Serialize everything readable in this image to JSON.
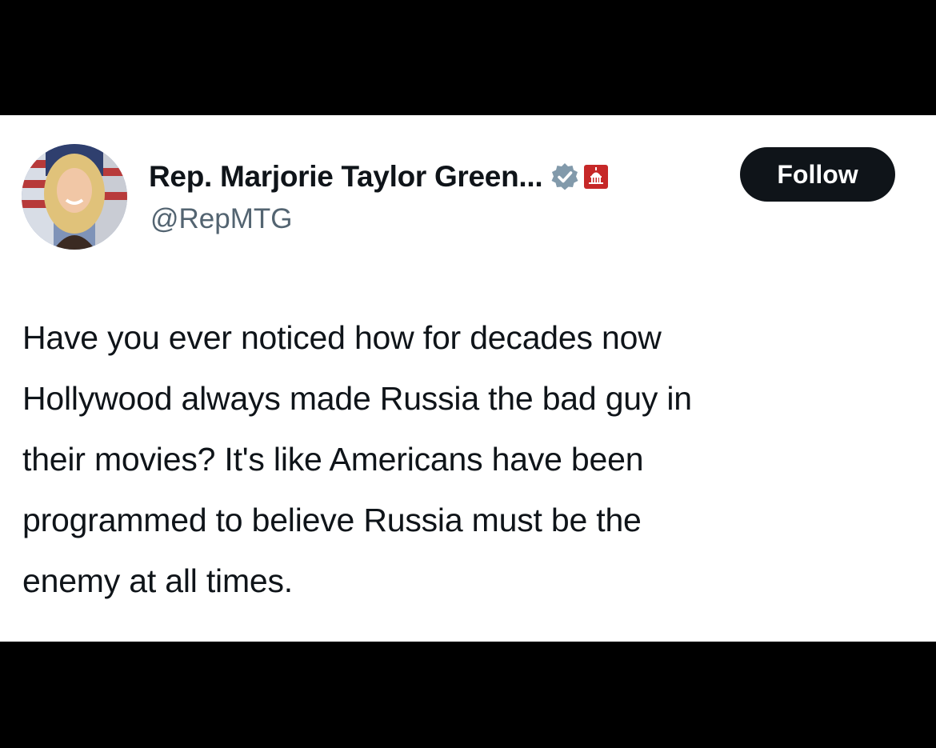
{
  "tweet": {
    "author": {
      "display_name": "Rep. Marjorie Taylor Green...",
      "handle": "@RepMTG",
      "verified_icon": "verified-badge-icon",
      "affiliation_icon": "capitol-building-icon"
    },
    "follow_label": "Follow",
    "text_lines": [
      "Have you ever noticed how for decades now",
      "Hollywood always made Russia the bad guy in",
      "their movies?  It's like Americans have been",
      "programmed to believe Russia must be the",
      "enemy at all times."
    ]
  },
  "colors": {
    "background": "#000000",
    "card": "#ffffff",
    "text_primary": "#0f1419",
    "text_secondary": "#536471",
    "verified_badge": "#829aab",
    "affiliation_badge": "#c62828"
  }
}
